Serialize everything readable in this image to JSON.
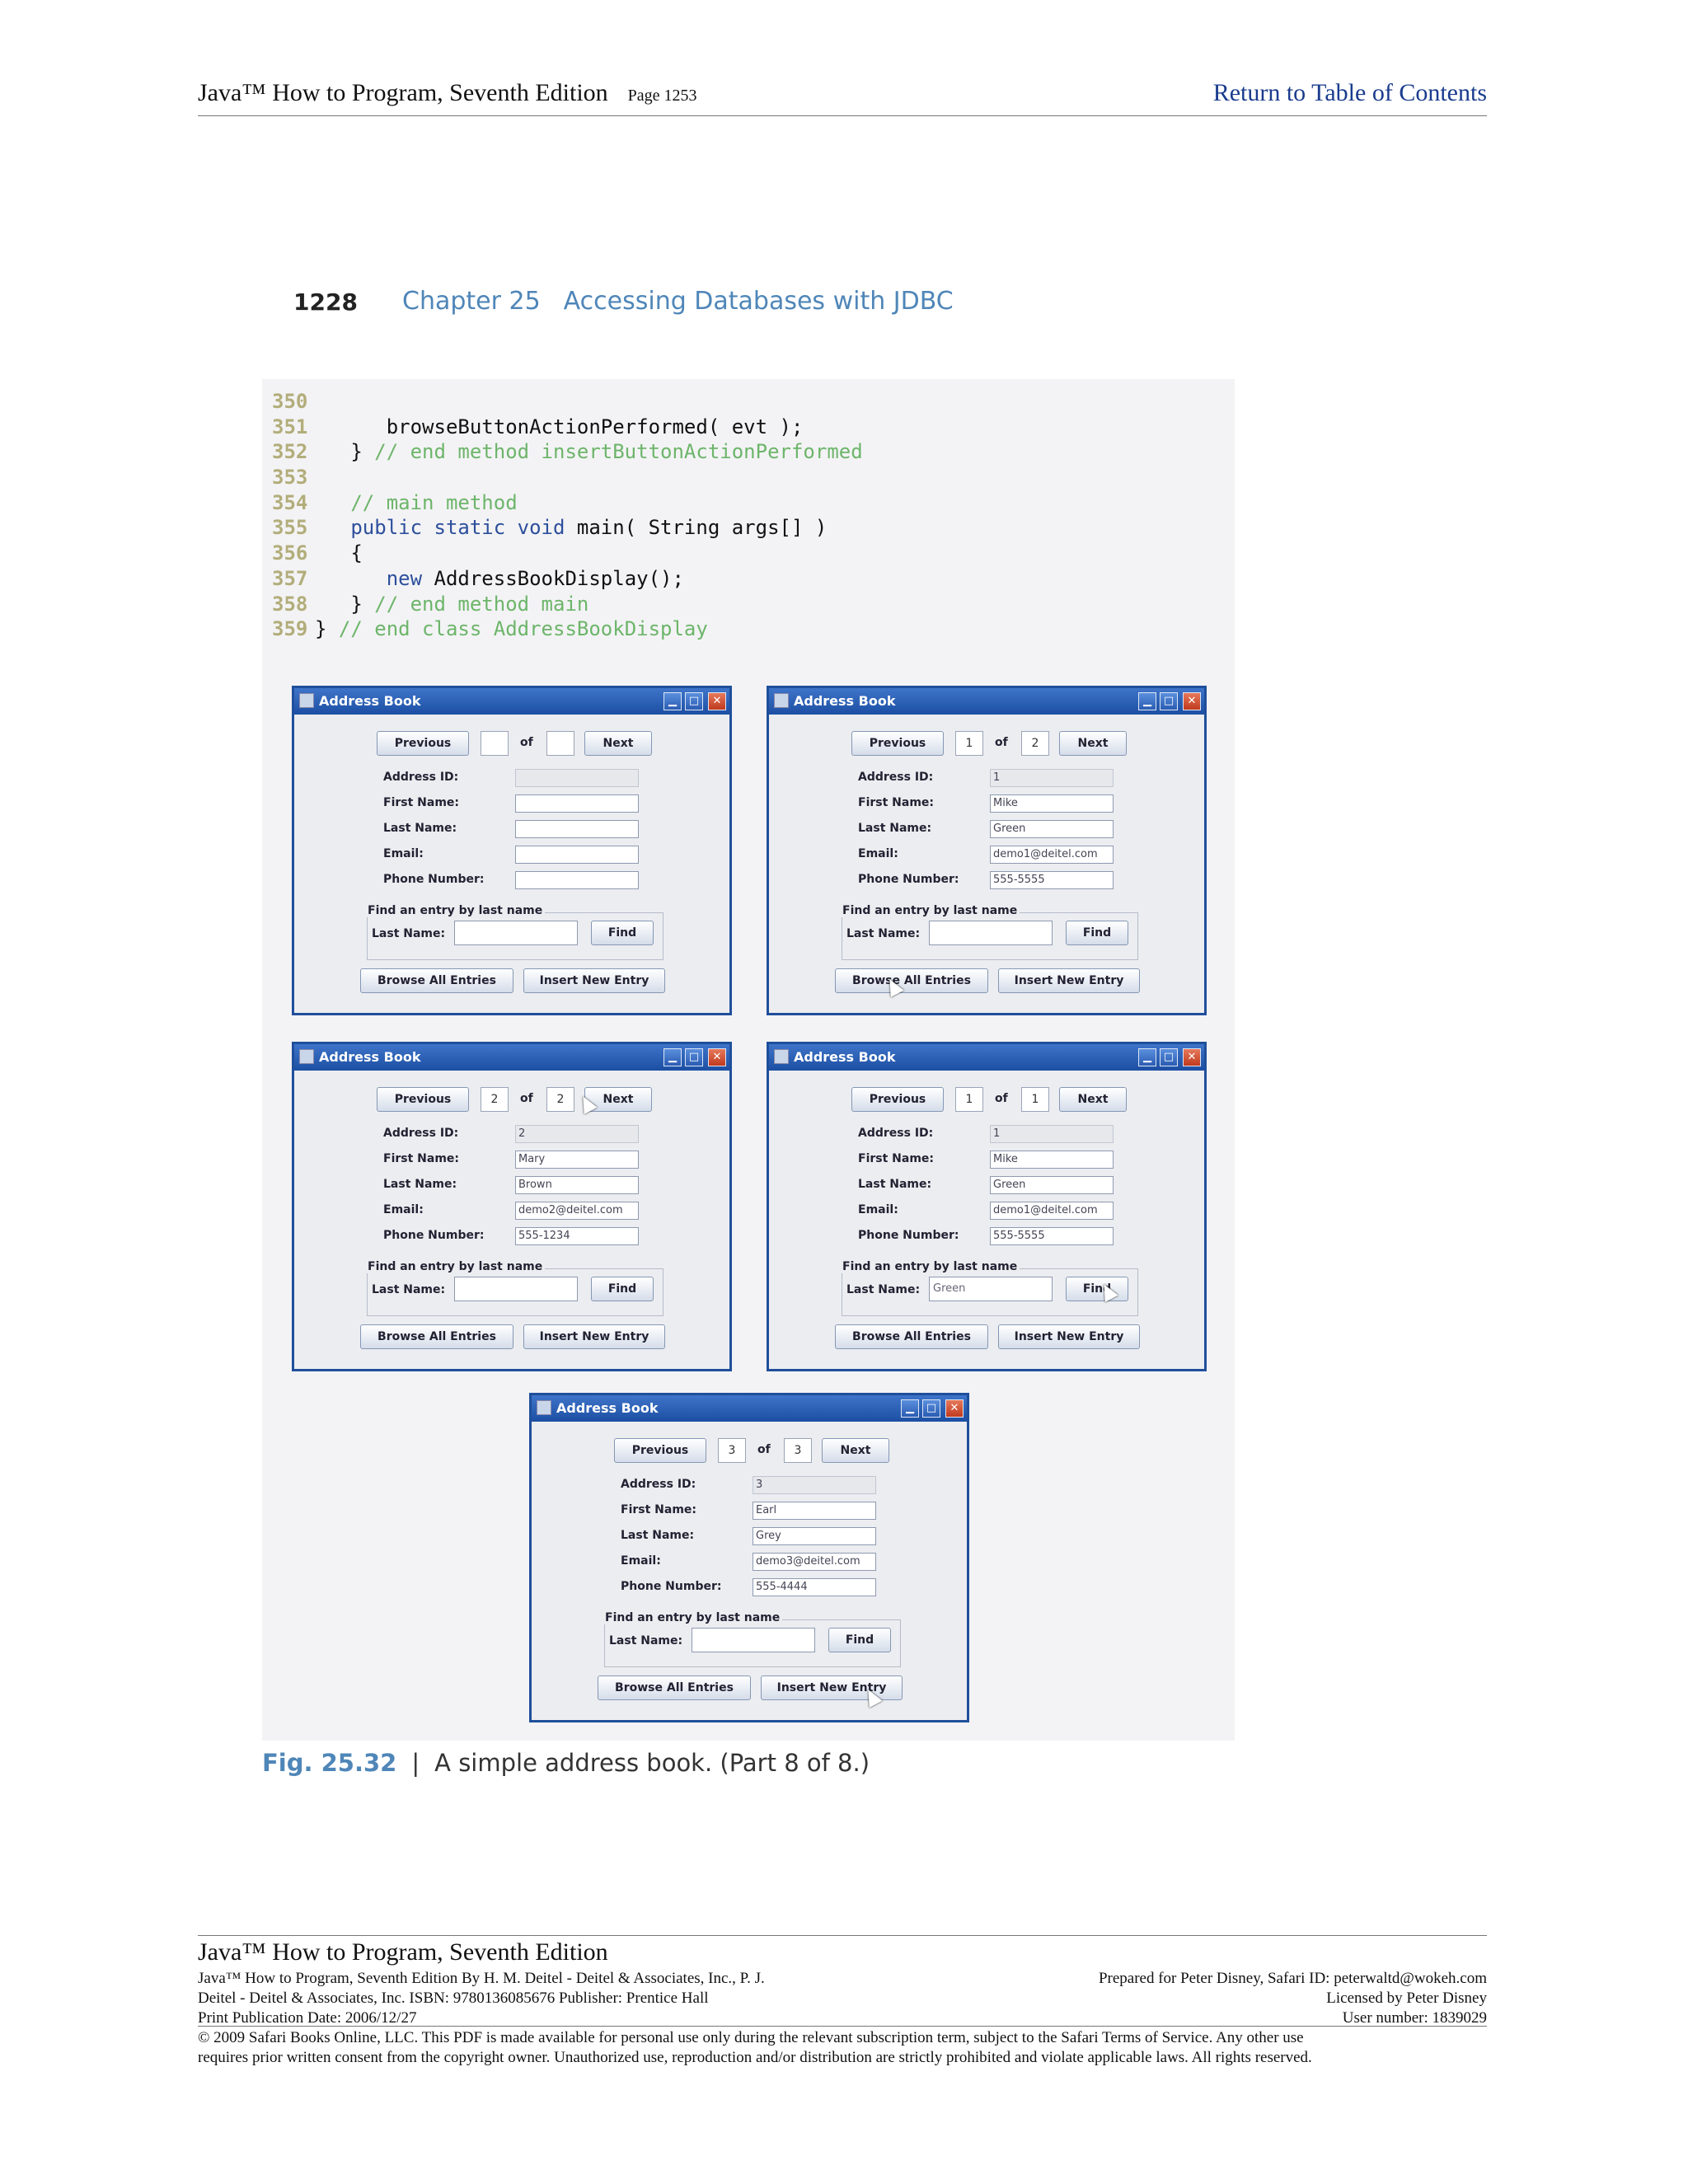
{
  "header": {
    "book_title": "Java™ How to Program, Seventh Edition",
    "page_label": "Page 1253",
    "toc_link": "Return to Table of Contents"
  },
  "chapter": {
    "page_number": "1228",
    "chapter_label": "Chapter 25",
    "chapter_title": "Accessing Databases with JDBC"
  },
  "code": [
    {
      "ln": "350",
      "parts": []
    },
    {
      "ln": "351",
      "parts": [
        {
          "t": "tx",
          "s": "      browseButtonActionPerformed( evt );"
        }
      ]
    },
    {
      "ln": "352",
      "parts": [
        {
          "t": "tx",
          "s": "   } "
        },
        {
          "t": "cm",
          "s": "// end method insertButtonActionPerformed"
        }
      ]
    },
    {
      "ln": "353",
      "parts": []
    },
    {
      "ln": "354",
      "parts": [
        {
          "t": "cm",
          "s": "   // main method"
        }
      ]
    },
    {
      "ln": "355",
      "parts": [
        {
          "t": "kw",
          "s": "   public static void "
        },
        {
          "t": "tx",
          "s": "main( String args[] )"
        }
      ]
    },
    {
      "ln": "356",
      "parts": [
        {
          "t": "tx",
          "s": "   {"
        }
      ]
    },
    {
      "ln": "357",
      "parts": [
        {
          "t": "kw",
          "s": "      new "
        },
        {
          "t": "tx",
          "s": "AddressBookDisplay();"
        }
      ]
    },
    {
      "ln": "358",
      "parts": [
        {
          "t": "tx",
          "s": "   } "
        },
        {
          "t": "cm",
          "s": "// end method main"
        }
      ]
    },
    {
      "ln": "359",
      "parts": [
        {
          "t": "tx",
          "s": "} "
        },
        {
          "t": "cm",
          "s": "// end class AddressBookDisplay"
        }
      ]
    }
  ],
  "ui_labels": {
    "window_title": "Address Book",
    "previous": "Previous",
    "next": "Next",
    "of": "of",
    "address_id": "Address ID:",
    "first_name": "First Name:",
    "last_name": "Last Name:",
    "email": "Email:",
    "phone": "Phone Number:",
    "find_group": "Find an entry by last name",
    "find_last_name": "Last Name:",
    "find": "Find",
    "browse": "Browse All Entries",
    "insert": "Insert New Entry"
  },
  "windows": [
    {
      "index": "",
      "total": "",
      "id": "",
      "first": "",
      "last": "",
      "email": "",
      "phone": "",
      "find_text": ""
    },
    {
      "index": "1",
      "total": "2",
      "id": "1",
      "first": "Mike",
      "last": "Green",
      "email": "demo1@deitel.com",
      "phone": "555-5555",
      "find_text": ""
    },
    {
      "index": "2",
      "total": "2",
      "id": "2",
      "first": "Mary",
      "last": "Brown",
      "email": "demo2@deitel.com",
      "phone": "555-1234",
      "find_text": ""
    },
    {
      "index": "1",
      "total": "1",
      "id": "1",
      "first": "Mike",
      "last": "Green",
      "email": "demo1@deitel.com",
      "phone": "555-5555",
      "find_text": "Green"
    },
    {
      "index": "3",
      "total": "3",
      "id": "3",
      "first": "Earl",
      "last": "Grey",
      "email": "demo3@deitel.com",
      "phone": "555-4444",
      "find_text": ""
    }
  ],
  "caption": {
    "fig": "Fig. 25.32",
    "separator": "|",
    "text": "A simple address book.  (Part 8 of 8.)"
  },
  "footer": {
    "title": "Java™ How to Program, Seventh Edition",
    "left_line1": "Java™ How to Program, Seventh Edition By H. M. Deitel - Deitel & Associates, Inc., P. J.",
    "left_line2": "Deitel - Deitel & Associates, Inc. ISBN: 9780136085676 Publisher: Prentice Hall",
    "left_line3": "Print Publication Date: 2006/12/27",
    "right_line1": "Prepared for Peter Disney, Safari ID: peterwaltd@wokeh.com",
    "right_line2": "Licensed by Peter Disney",
    "right_line3": "User number: 1839029",
    "copyright_line1": "© 2009 Safari Books Online, LLC. This PDF is made available for personal use only during the relevant subscription term, subject to the Safari Terms of Service. Any other use",
    "copyright_line2": "requires prior written consent from the copyright owner. Unauthorized use, reproduction and/or distribution are strictly prohibited and violate applicable laws. All rights reserved."
  }
}
